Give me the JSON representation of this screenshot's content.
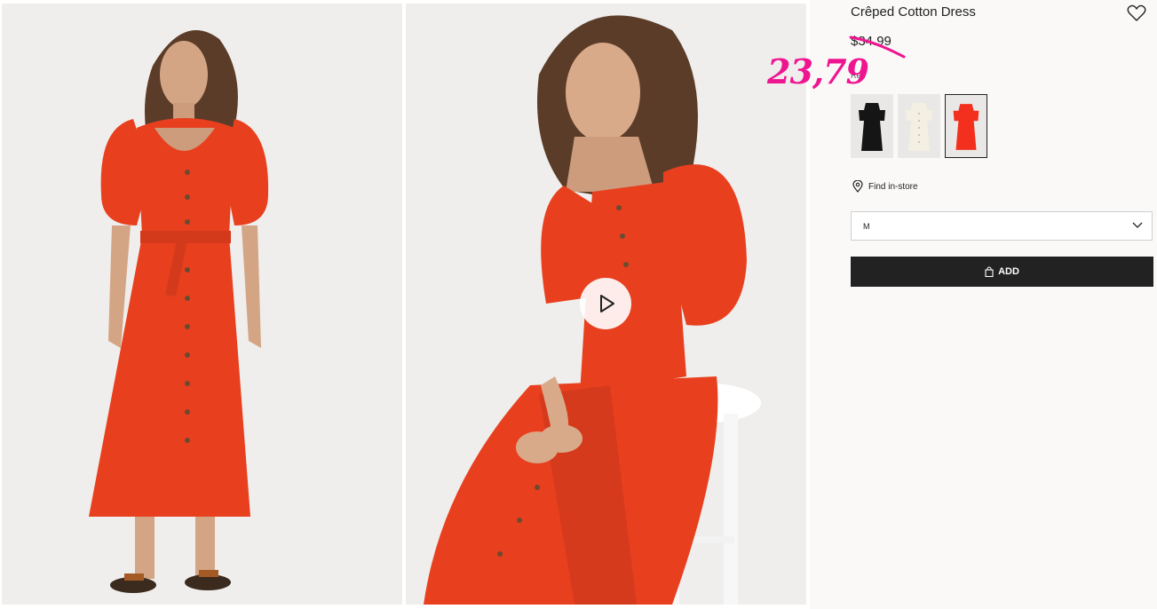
{
  "product": {
    "title": "Crêped Cotton Dress",
    "old_price": "$34.99",
    "sale_price": "23,79",
    "color_label": "Red",
    "find_in_store": "Find in-store",
    "size": "M",
    "add_label": "ADD"
  },
  "swatches": [
    {
      "name": "Black",
      "color": "#151515",
      "selected": false
    },
    {
      "name": "White",
      "color": "#f3efe2",
      "selected": false
    },
    {
      "name": "Red",
      "color": "#f2301d",
      "selected": true
    }
  ],
  "colors": {
    "dress": "#e8401f",
    "sale_accent": "#ef1591",
    "button": "#222222"
  },
  "icons": [
    "heart-icon",
    "play-icon",
    "location-pin-icon",
    "chevron-down-icon",
    "shopping-bag-icon"
  ]
}
